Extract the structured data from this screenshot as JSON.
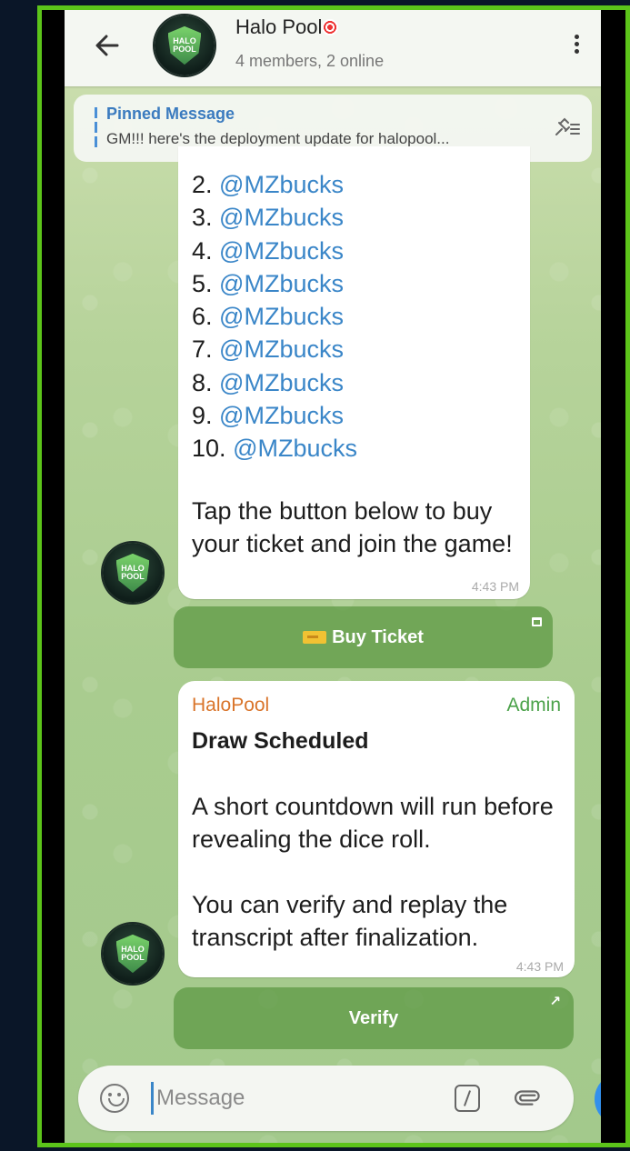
{
  "header": {
    "title": "Halo Pool",
    "subtitle": "4 members, 2 online",
    "avatar_text": "HALO POOL"
  },
  "pinned": {
    "title": "Pinned Message",
    "text": "GM!!! here's the deployment update for halopool..."
  },
  "message1": {
    "list": [
      {
        "num": "2.",
        "mention": "@MZbucks"
      },
      {
        "num": "3.",
        "mention": "@MZbucks"
      },
      {
        "num": "4.",
        "mention": "@MZbucks"
      },
      {
        "num": "5.",
        "mention": "@MZbucks"
      },
      {
        "num": "6.",
        "mention": "@MZbucks"
      },
      {
        "num": "7.",
        "mention": "@MZbucks"
      },
      {
        "num": "8.",
        "mention": "@MZbucks"
      },
      {
        "num": "9.",
        "mention": "@MZbucks"
      },
      {
        "num": "10.",
        "mention": "@MZbucks"
      }
    ],
    "text": "Tap the button below to buy your ticket and join the game!",
    "time": "4:43 PM",
    "button_label": "Buy Ticket"
  },
  "message2": {
    "sender": "HaloPool",
    "role": "Admin",
    "title": "Draw Scheduled",
    "paragraph1": "A short countdown will run before revealing the dice roll.",
    "paragraph2": "You can verify and replay the transcript after finalization.",
    "time": "4:43 PM",
    "button_label": "Verify",
    "button_corner": "↗"
  },
  "input": {
    "placeholder": "Message"
  },
  "colors": {
    "mention": "#3a86c8",
    "sender": "#d9742a",
    "admin": "#4ba24a",
    "accent": "#3390ec",
    "frame": "#5cc41a"
  }
}
